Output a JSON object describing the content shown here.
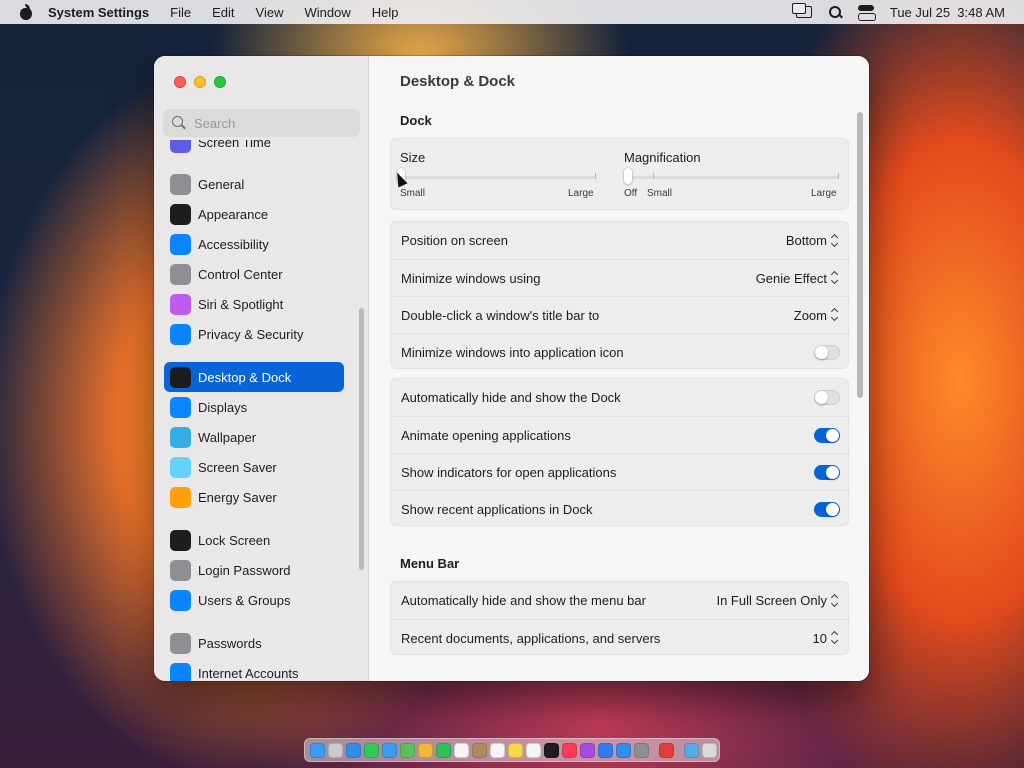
{
  "menubar": {
    "app_name": "System Settings",
    "items": [
      "File",
      "Edit",
      "View",
      "Window",
      "Help"
    ],
    "clock": "Tue Jul 25  3:48 AM"
  },
  "sidebar": {
    "search_placeholder": "Search",
    "items": [
      {
        "label": "Screen Time",
        "icon": "hourglass-icon",
        "color": "#5e5ce6"
      },
      {
        "label": "General",
        "icon": "gear-icon",
        "color": "#8e8e93"
      },
      {
        "label": "Appearance",
        "icon": "appearance-icon",
        "color": "#1d1d1f"
      },
      {
        "label": "Accessibility",
        "icon": "accessibility-icon",
        "color": "#0a84ff"
      },
      {
        "label": "Control Center",
        "icon": "control-center-icon",
        "color": "#8e8e93"
      },
      {
        "label": "Siri & Spotlight",
        "icon": "siri-icon",
        "color": "#bf5af2"
      },
      {
        "label": "Privacy & Security",
        "icon": "hand-icon",
        "color": "#0a84ff"
      },
      {
        "label": "Desktop & Dock",
        "icon": "desktop-dock-icon",
        "color": "#1d1d1f"
      },
      {
        "label": "Displays",
        "icon": "sun-icon",
        "color": "#0a84ff"
      },
      {
        "label": "Wallpaper",
        "icon": "wallpaper-icon",
        "color": "#32ade6"
      },
      {
        "label": "Screen Saver",
        "icon": "screen-saver-icon",
        "color": "#64d2ff"
      },
      {
        "label": "Energy Saver",
        "icon": "lightbulb-icon",
        "color": "#ff9f0a"
      },
      {
        "label": "Lock Screen",
        "icon": "lock-icon",
        "color": "#1d1d1f"
      },
      {
        "label": "Login Password",
        "icon": "login-lock-icon",
        "color": "#8e8e93"
      },
      {
        "label": "Users & Groups",
        "icon": "users-icon",
        "color": "#0a84ff"
      },
      {
        "label": "Passwords",
        "icon": "key-icon",
        "color": "#8e8e93"
      },
      {
        "label": "Internet Accounts",
        "icon": "at-icon",
        "color": "#0a84ff"
      }
    ]
  },
  "content": {
    "title": "Desktop & Dock",
    "dock_section": "Dock",
    "size": {
      "label": "Size",
      "min_label": "Small",
      "max_label": "Large",
      "value": 0
    },
    "magnification": {
      "label": "Magnification",
      "off_label": "Off",
      "min_label": "Small",
      "max_label": "Large",
      "value": 0
    },
    "group1": [
      {
        "label": "Position on screen",
        "value": "Bottom"
      },
      {
        "label": "Minimize windows using",
        "value": "Genie Effect"
      },
      {
        "label": "Double-click a window's title bar to",
        "value": "Zoom"
      },
      {
        "label": "Minimize windows into application icon",
        "toggle": false
      }
    ],
    "group2": [
      {
        "label": "Automatically hide and show the Dock",
        "toggle": false
      },
      {
        "label": "Animate opening applications",
        "toggle": true
      },
      {
        "label": "Show indicators for open applications",
        "toggle": true
      },
      {
        "label": "Show recent applications in Dock",
        "toggle": true
      }
    ],
    "menubar_section": "Menu Bar",
    "group3": [
      {
        "label": "Automatically hide and show the menu bar",
        "value": "In Full Screen Only"
      },
      {
        "label": "Recent documents, applications, and servers",
        "value": "10"
      }
    ]
  },
  "dock": {
    "icons": [
      {
        "icon": "finder-icon",
        "color": "#3b9cf5"
      },
      {
        "icon": "launchpad-icon",
        "color": "#c9c9d0"
      },
      {
        "icon": "safari-icon",
        "color": "#2f8ef0"
      },
      {
        "icon": "messages-icon",
        "color": "#34c759"
      },
      {
        "icon": "mail-icon",
        "color": "#3a9df3"
      },
      {
        "icon": "maps-icon",
        "color": "#5ac05a"
      },
      {
        "icon": "photos-icon",
        "color": "#f1b83a"
      },
      {
        "icon": "facetime-icon",
        "color": "#30c15a"
      },
      {
        "icon": "calendar-icon",
        "color": "#f5f5f5"
      },
      {
        "icon": "contacts-icon",
        "color": "#b08a5a"
      },
      {
        "icon": "reminders-icon",
        "color": "#f5f5f5"
      },
      {
        "icon": "notes-icon",
        "color": "#f7d64a"
      },
      {
        "icon": "freeform-icon",
        "color": "#f5f5f5"
      },
      {
        "icon": "tv-icon",
        "color": "#1d1d1f"
      },
      {
        "icon": "music-icon",
        "color": "#fa3c55"
      },
      {
        "icon": "podcasts-icon",
        "color": "#a44be0"
      },
      {
        "icon": "keynote-icon",
        "color": "#2f7cf0"
      },
      {
        "icon": "app-store-icon",
        "color": "#2f8ef0"
      },
      {
        "icon": "system-settings-icon",
        "color": "#8e8e93"
      },
      {
        "icon": "preview-app-icon",
        "color": "#e23c3c"
      },
      {
        "icon": "downloads-folder-icon",
        "color": "#5aa8e6"
      },
      {
        "icon": "trash-icon",
        "color": "#dadadd"
      }
    ]
  }
}
